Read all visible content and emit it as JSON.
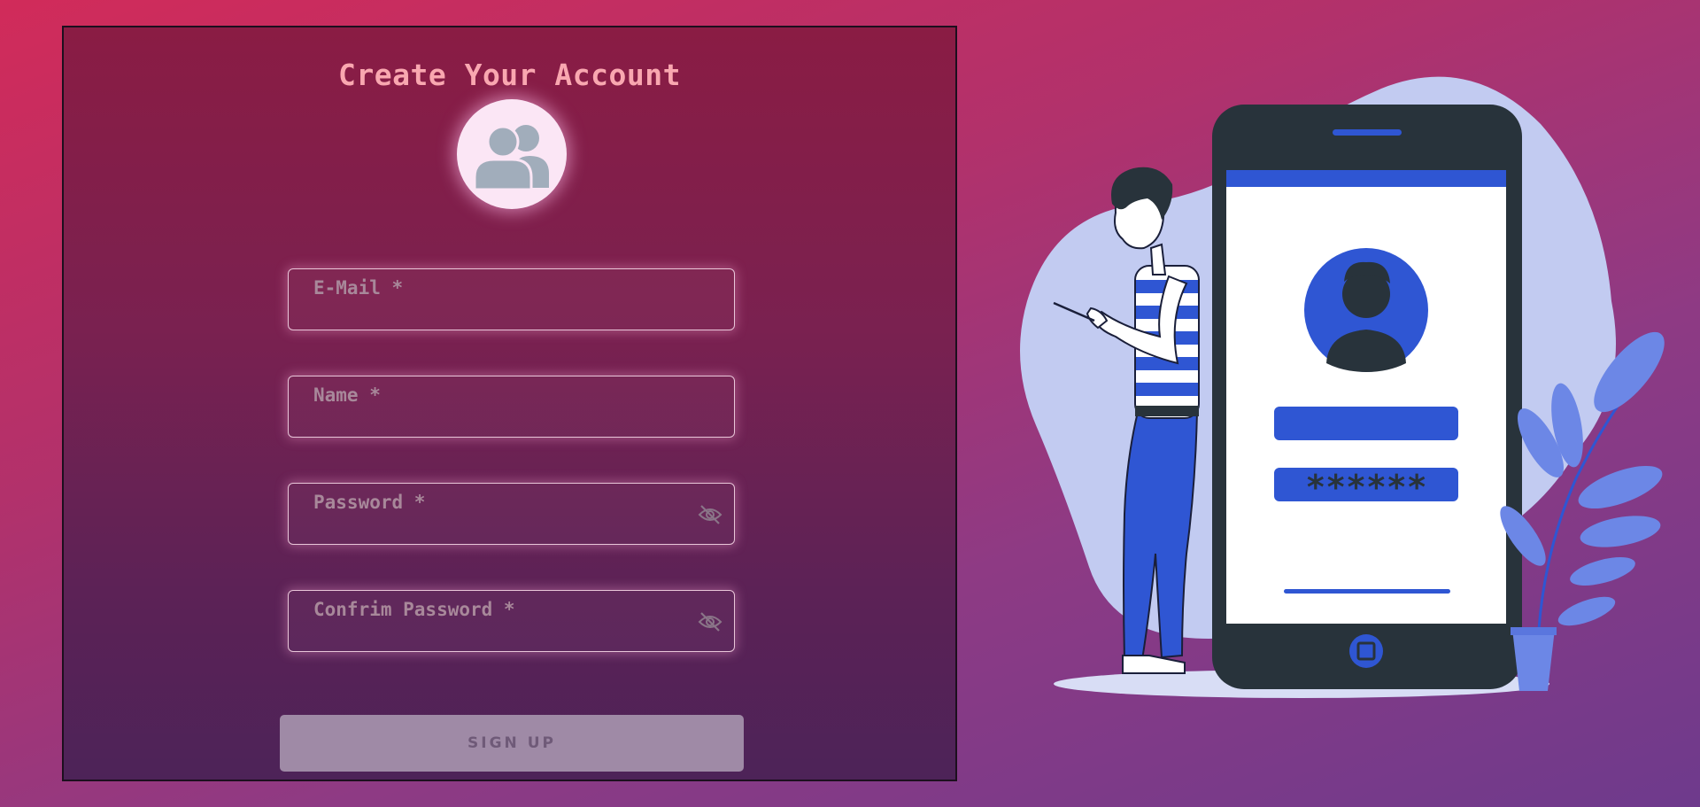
{
  "form": {
    "title": "Create Your Account",
    "avatar_icon": "users-icon",
    "fields": [
      {
        "placeholder": "E-Mail *",
        "type": "email"
      },
      {
        "placeholder": "Name *",
        "type": "text"
      },
      {
        "placeholder": "Password *",
        "type": "password",
        "icon": "eye-slash-icon"
      },
      {
        "placeholder": "Confrim Password *",
        "type": "password",
        "icon": "eye-slash-icon"
      }
    ],
    "submit_label": "SIGN UP"
  },
  "illustration": {
    "password_mask": "******"
  },
  "colors": {
    "title": "#f9a7b0",
    "accent_blue": "#2f56d3",
    "button_bg": "#9f8aa6"
  }
}
